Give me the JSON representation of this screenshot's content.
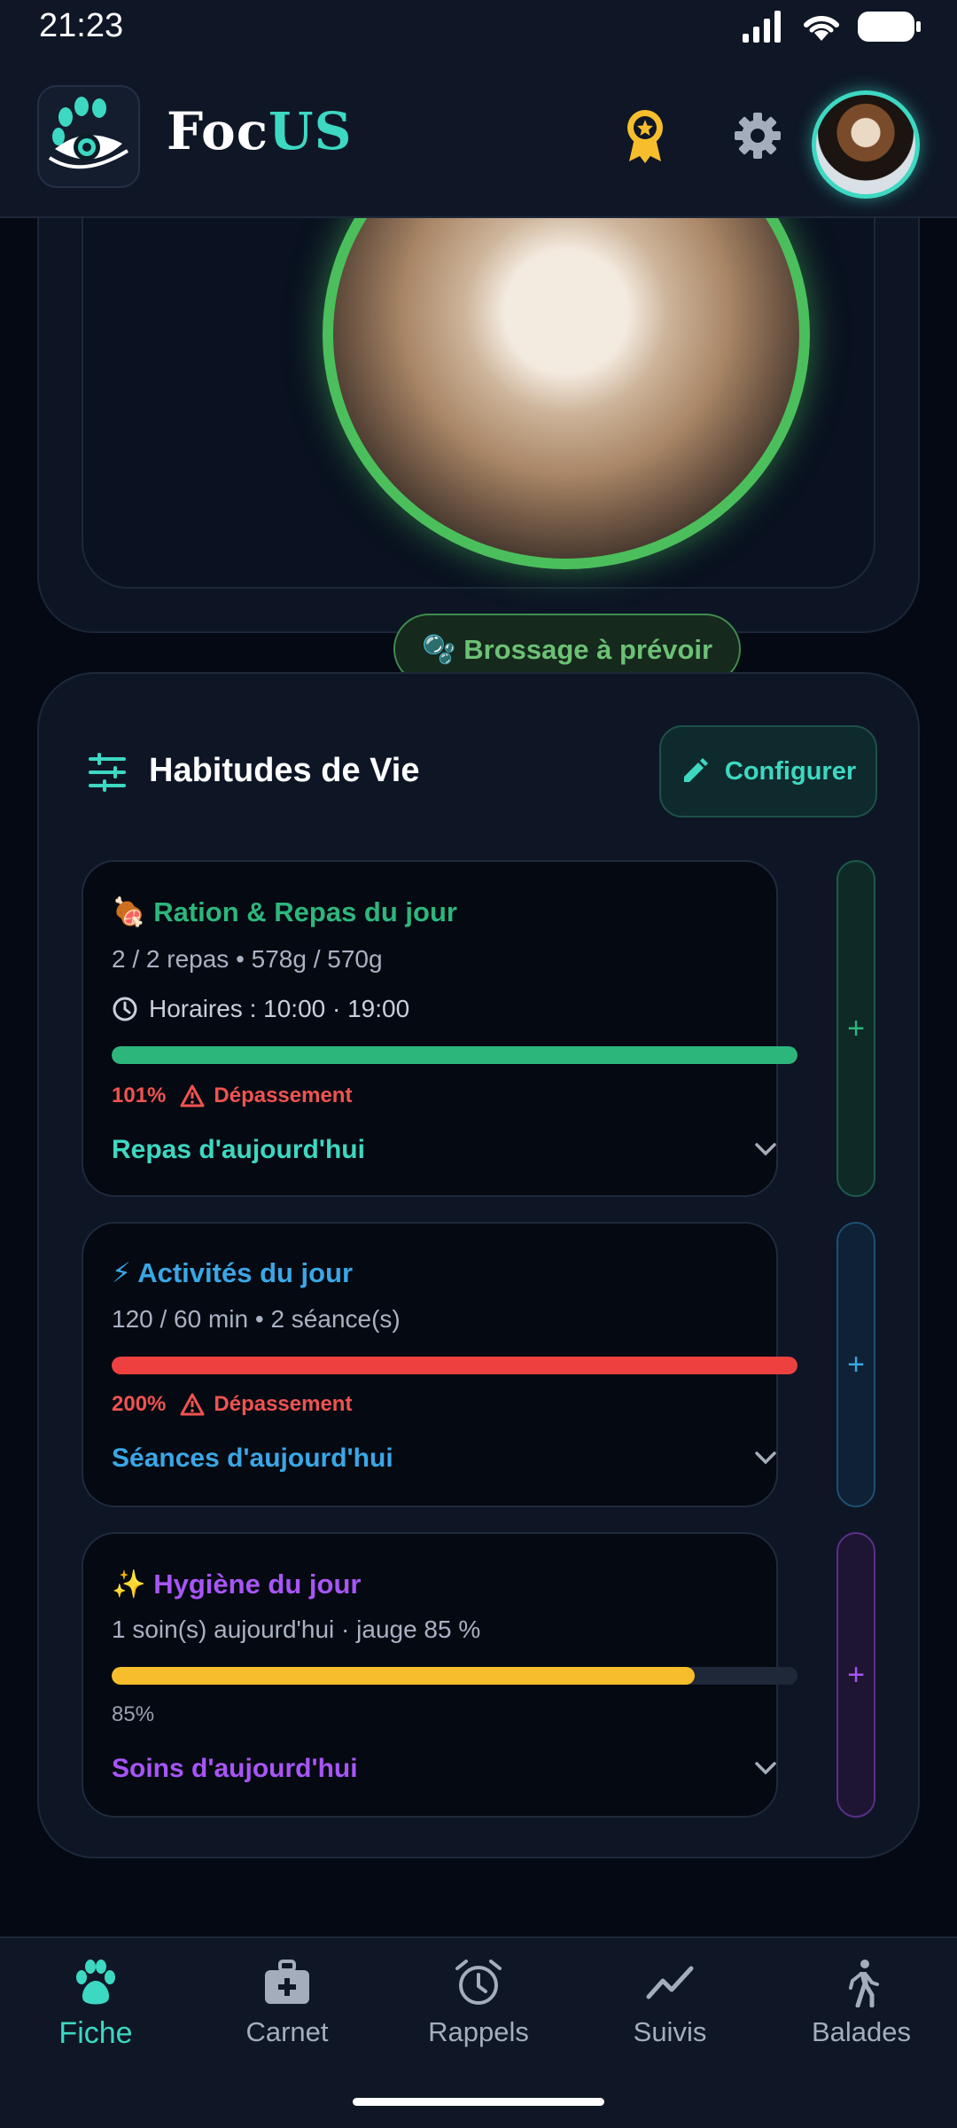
{
  "status": {
    "time": "21:23"
  },
  "header": {
    "brand_part1": "Foc",
    "brand_part2": "US"
  },
  "grooming": {
    "badge": "🫧 Brossage à prévoir"
  },
  "habits": {
    "title": "Habitudes de Vie",
    "configure_label": "Configurer",
    "cards": [
      {
        "title": "🍖 Ration & Repas du jour",
        "summary": "2 / 2 repas • 578g / 570g",
        "hours": "Horaires : 10:00 · 19:00",
        "percent_label": "101%",
        "progress": 1.0,
        "warning": "Dépassement",
        "link": "Repas d'aujourd'hui",
        "color": "#2db67c",
        "add": "+"
      },
      {
        "title": "⚡ Activités du jour",
        "summary": "120 / 60 min • 2 séance(s)",
        "percent_label": "200%",
        "progress": 1.0,
        "warning": "Dépassement",
        "link": "Séances d'aujourd'hui",
        "color": "#3aa7e6",
        "add": "+"
      },
      {
        "title": "✨ Hygiène du jour",
        "summary": "1 soin(s) aujourd'hui · jauge 85 %",
        "percent_label": "85%",
        "progress": 0.85,
        "link": "Soins d'aujourd'hui",
        "color": "#a855f7",
        "add": "+"
      }
    ]
  },
  "nav": [
    {
      "label": "Fiche",
      "active": true
    },
    {
      "label": "Carnet"
    },
    {
      "label": "Rappels"
    },
    {
      "label": "Suivis"
    },
    {
      "label": "Balades"
    }
  ],
  "colors": {
    "accent": "#3dd8c2",
    "danger": "#ef5350",
    "warning_bar": "#f6be2c",
    "success": "#4bbf5c"
  }
}
